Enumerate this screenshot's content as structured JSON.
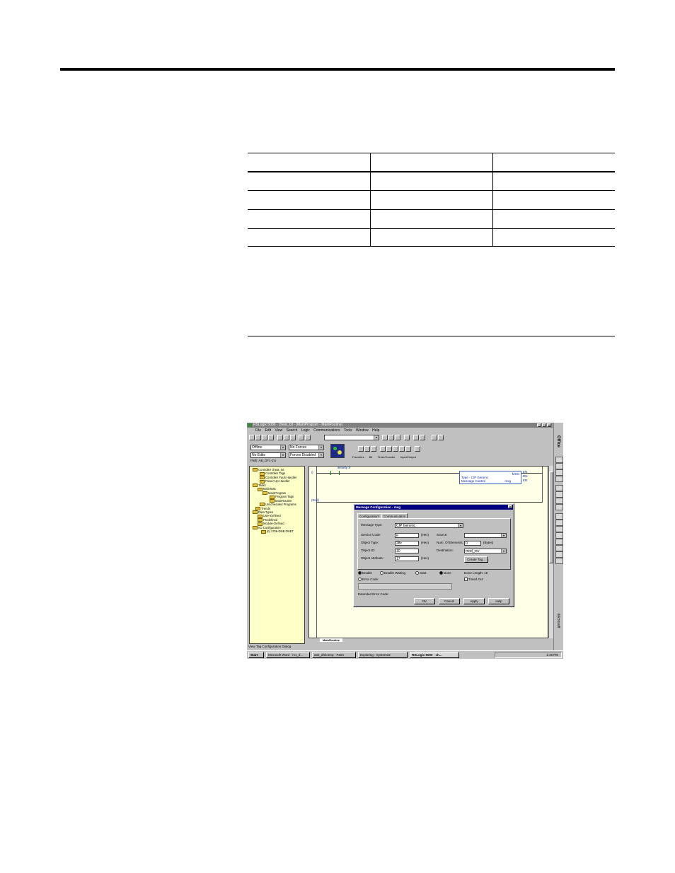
{
  "screenshot": {
    "title": "RSLogix 5000 - cheat_txt - [MainProgram - MainRoutine]",
    "menu": [
      "File",
      "Edit",
      "View",
      "Search",
      "Logic",
      "Communications",
      "Tools",
      "Window",
      "Help"
    ],
    "mode": {
      "state": "Offline",
      "forces": "No Forces",
      "edits": "No Edits",
      "forces_status": "Forces Disabled",
      "path": "Path: AB_DF1-1\\1"
    },
    "ladder_tabs": [
      "Favorites",
      "Bit",
      "Timer/Counter",
      "Input/Output"
    ],
    "tree": [
      "Controller cheat_txt",
      "Controller Tags",
      "Controller Fault Handler",
      "Power-Up Handler",
      "Tasks",
      "MainTask",
      "MainProgram",
      "Program Tags",
      "MainRoutine",
      "Unscheduled Programs",
      "Trends",
      "Data Types",
      "User-Defined",
      "Predefined",
      "Module-Defined",
      "I/O Configuration",
      "[0] 1756-DNB DNET"
    ],
    "rung": {
      "number": "0",
      "contact_tag": "ileniety X",
      "instruction": "MSG",
      "instr_type": "Type - CIP Generic",
      "instr_control": "Message Control",
      "control_tag": "msg",
      "outputs": [
        "EN",
        "DN",
        "ER"
      ],
      "end_label": "(End)"
    },
    "dialog": {
      "title": "Message Configuration - msg",
      "tabs": [
        "Configuration*",
        "Communication"
      ],
      "message_type_label": "Message Type:",
      "message_type": "CIP Generic",
      "service_code_label": "Service Code:",
      "service_code": "e",
      "object_type_label": "Object Type:",
      "object_type": "28c",
      "object_id_label": "Object ID:",
      "object_id": "10",
      "object_attribute_label": "Object Attribute:",
      "object_attribute": "17",
      "hex": "(Hex)",
      "source_label": "Source:",
      "source": "",
      "num_elements_label": "Num. Of Elements:",
      "num_elements": "0",
      "bytes": "(Bytes)",
      "destination_label": "Destination:",
      "destination": "mod_rev",
      "create_tag": "Create Tag...",
      "status": [
        "Enable",
        "Enable Waiting",
        "Start",
        "Done"
      ],
      "done_length": "Done Length: 18",
      "error_code": "Error Code:",
      "timed_out": "Timed Out",
      "extended_error": "Extended Error Code:",
      "buttons": [
        "OK",
        "Cancel",
        "Apply",
        "Help"
      ]
    },
    "sheet_tab": "MainRoutine",
    "status_bar": "View Tag Configuration Dialog",
    "taskbar": {
      "start": "Start",
      "tasks": [
        "Microsoft Word - rs1_d...",
        "a02_dhb.bmp - Paint",
        "Exploring - System32",
        "RSLogix 5000 - ch..."
      ],
      "clock": "1:48 PM"
    },
    "office_bar": [
      "Office",
      "Microsoft"
    ]
  }
}
